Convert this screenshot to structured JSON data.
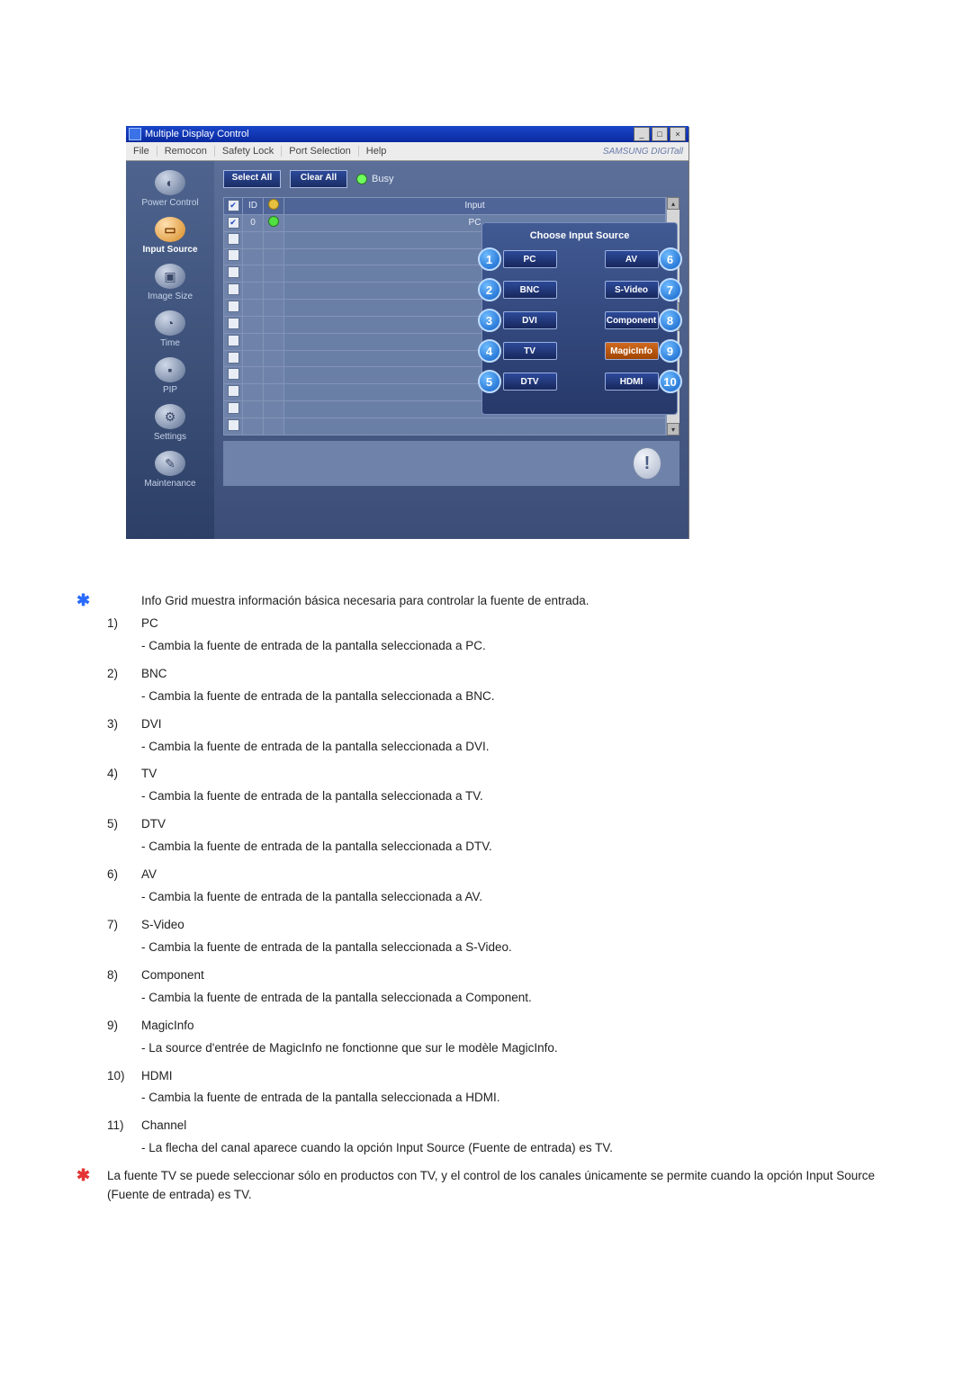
{
  "app": {
    "title": "Multiple Display Control",
    "window_buttons": {
      "min": "_",
      "max": "□",
      "close": "×"
    },
    "menus": [
      "File",
      "Remocon",
      "Safety Lock",
      "Port Selection",
      "Help"
    ],
    "brand": "SAMSUNG DIGITall"
  },
  "sidebar": [
    {
      "label": "Power Control",
      "icon": "◐"
    },
    {
      "label": "Input Source",
      "icon": "▭",
      "active": true
    },
    {
      "label": "Image Size",
      "icon": "▣"
    },
    {
      "label": "Time",
      "icon": "◔"
    },
    {
      "label": "PIP",
      "icon": "▪"
    },
    {
      "label": "Settings",
      "icon": "⚙"
    },
    {
      "label": "Maintenance",
      "icon": "✎"
    }
  ],
  "toolbar": {
    "select_all": "Select All",
    "clear_all": "Clear All",
    "busy": "Busy"
  },
  "grid": {
    "headers": {
      "id": "ID",
      "input": "Input"
    },
    "first_row": {
      "id": "0",
      "input": "PC"
    }
  },
  "source_panel": {
    "title": "Choose Input Source",
    "left": [
      {
        "n": "1",
        "t": "PC"
      },
      {
        "n": "2",
        "t": "BNC"
      },
      {
        "n": "3",
        "t": "DVI"
      },
      {
        "n": "4",
        "t": "TV"
      },
      {
        "n": "5",
        "t": "DTV"
      }
    ],
    "right": [
      {
        "n": "6",
        "t": "AV"
      },
      {
        "n": "7",
        "t": "S-Video"
      },
      {
        "n": "8",
        "t": "Component"
      },
      {
        "n": "9",
        "t": "MagicInfo"
      },
      {
        "n": "10",
        "t": "HDMI"
      }
    ]
  },
  "footer_icon": "!",
  "doc": {
    "intro": "Info Grid muestra información básica necesaria para controlar la fuente de entrada.",
    "items": [
      {
        "n": "1)",
        "t": "PC",
        "d": "Cambia la fuente de entrada de la pantalla seleccionada a PC."
      },
      {
        "n": "2)",
        "t": "BNC",
        "d": "Cambia la fuente de entrada de la pantalla seleccionada a BNC."
      },
      {
        "n": "3)",
        "t": "DVI",
        "d": "Cambia la fuente de entrada de la pantalla seleccionada a DVI."
      },
      {
        "n": "4)",
        "t": "TV",
        "d": "Cambia la fuente de entrada de la pantalla seleccionada a TV."
      },
      {
        "n": "5)",
        "t": "DTV",
        "d": "Cambia la fuente de entrada de la pantalla seleccionada a DTV."
      },
      {
        "n": "6)",
        "t": "AV",
        "d": "Cambia la fuente de entrada de la pantalla seleccionada a AV."
      },
      {
        "n": "7)",
        "t": "S-Video",
        "d": "Cambia la fuente de entrada de la pantalla seleccionada a S-Video."
      },
      {
        "n": "8)",
        "t": "Component",
        "d": "Cambia la fuente de entrada de la pantalla seleccionada a Component."
      },
      {
        "n": "9)",
        "t": "MagicInfo",
        "d": "La source d'entrée de MagicInfo ne fonctionne que sur le modèle MagicInfo."
      },
      {
        "n": "10)",
        "t": "HDMI",
        "d": "Cambia la fuente de entrada de la pantalla seleccionada a HDMI."
      },
      {
        "n": "11)",
        "t": "Channel",
        "d": "La flecha del canal aparece cuando la opción Input Source (Fuente de entrada) es TV."
      }
    ],
    "footnote": "La fuente TV se puede seleccionar sólo en productos con TV, y el control de los canales únicamente se permite cuando la opción Input Source (Fuente de entrada) es TV."
  }
}
